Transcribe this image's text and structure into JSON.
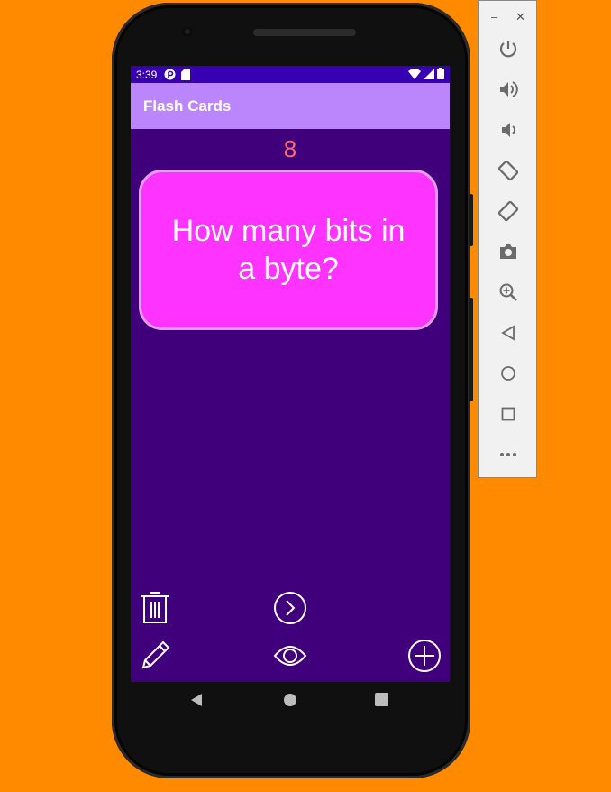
{
  "status": {
    "time": "3:39"
  },
  "app": {
    "title": "Flash Cards"
  },
  "card": {
    "count": "8",
    "question": "How many bits in a byte?"
  },
  "colors": {
    "background": "#ff8a00",
    "screen": "#41007b",
    "statusbar": "#3700b3",
    "appbar": "#bb86fc",
    "card": "#ff33ff",
    "count": "#ff6b6b"
  },
  "actions": [
    {
      "icon": "trash-icon"
    },
    {
      "icon": "next-icon"
    },
    {
      "icon": "pencil-icon"
    },
    {
      "icon": "eye-icon"
    },
    {
      "icon": "add-icon"
    }
  ],
  "emulator_controls": [
    "power-icon",
    "volume-up-icon",
    "volume-down-icon",
    "rotate-left-icon",
    "rotate-right-icon",
    "camera-icon",
    "zoom-icon",
    "back-icon",
    "home-icon",
    "overview-icon",
    "more-icon"
  ]
}
